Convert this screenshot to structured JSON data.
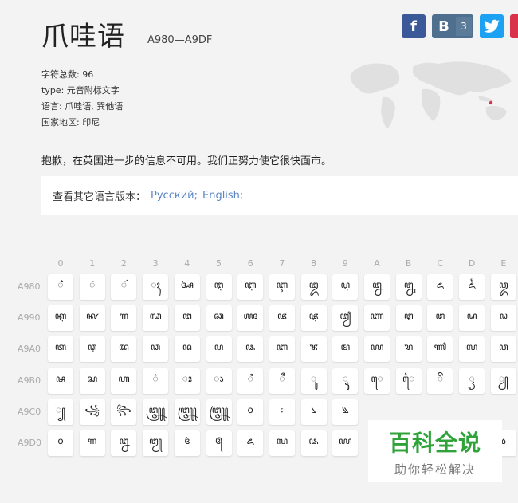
{
  "header": {
    "title": "爪哇语",
    "range": "A980—A9DF"
  },
  "social": {
    "vk_count": "3",
    "fb_label": "f",
    "vk_label": "B"
  },
  "meta": [
    {
      "label": "字符总数:",
      "value": "96"
    },
    {
      "label": "type:",
      "value": "元音附标文字"
    },
    {
      "label": "语言:",
      "value": "爪哇语, 巽他语"
    },
    {
      "label": "国家地区:",
      "value": "印尼"
    }
  ],
  "notice": "抱歉，在英国进一步的信息不可用。我们正努力使它很快面市。",
  "languages": {
    "label": "查看其它语言版本：",
    "links": [
      "Русский;",
      "English;"
    ]
  },
  "columns": [
    "0",
    "1",
    "2",
    "3",
    "4",
    "5",
    "6",
    "7",
    "8",
    "9",
    "A",
    "B",
    "C",
    "D",
    "E"
  ],
  "rows": [
    {
      "label": "A980",
      "glyphs": [
        "ꦀ",
        "ꦁ",
        "ꦂ",
        "ꦃ",
        "ꦄ",
        "ꦅ",
        "ꦆ",
        "ꦇ",
        "ꦈ",
        "ꦉ",
        "ꦊ",
        "ꦋ",
        "ꦌ",
        "ꦍ",
        "ꦎ"
      ]
    },
    {
      "label": "A990",
      "glyphs": [
        "ꦐ",
        "ꦑ",
        "ꦒ",
        "ꦓ",
        "ꦔ",
        "ꦕ",
        "ꦖ",
        "ꦗ",
        "ꦘ",
        "ꦙ",
        "ꦚ",
        "ꦛ",
        "ꦜ",
        "ꦝ",
        "ꦞ"
      ]
    },
    {
      "label": "A9A0",
      "glyphs": [
        "ꦠ",
        "ꦡ",
        "ꦢ",
        "ꦣ",
        "ꦤ",
        "ꦥ",
        "ꦦ",
        "ꦧ",
        "ꦨ",
        "ꦩ",
        "ꦪ",
        "ꦫ",
        "ꦬ",
        "ꦭ",
        "ꦮ"
      ]
    },
    {
      "label": "A9B0",
      "glyphs": [
        "ꦰ",
        "ꦱ",
        "ꦲ",
        "꦳",
        "ꦴ",
        "ꦵ",
        "ꦶ",
        "ꦷ",
        "ꦸ",
        "ꦹ",
        "ꦺ",
        "ꦻ",
        "ꦼ",
        "ꦽ",
        "ꦾ"
      ]
    },
    {
      "label": "A9C0",
      "glyphs": [
        "꧀",
        "꧁",
        "꧂",
        "꧃",
        "꧄",
        "꧅",
        "꧆",
        "꧇",
        "꧈",
        "꧉",
        "",
        "",
        "",
        "",
        ""
      ]
    },
    {
      "label": "A9D0",
      "glyphs": [
        "꧐",
        "꧑",
        "꧒",
        "꧓",
        "꧔",
        "꧕",
        "꧖",
        "꧗",
        "꧘",
        "꧙",
        "",
        "",
        "",
        "",
        "꧞"
      ]
    }
  ],
  "watermark": {
    "main": "百科全说",
    "sub": "助你轻松解决"
  }
}
